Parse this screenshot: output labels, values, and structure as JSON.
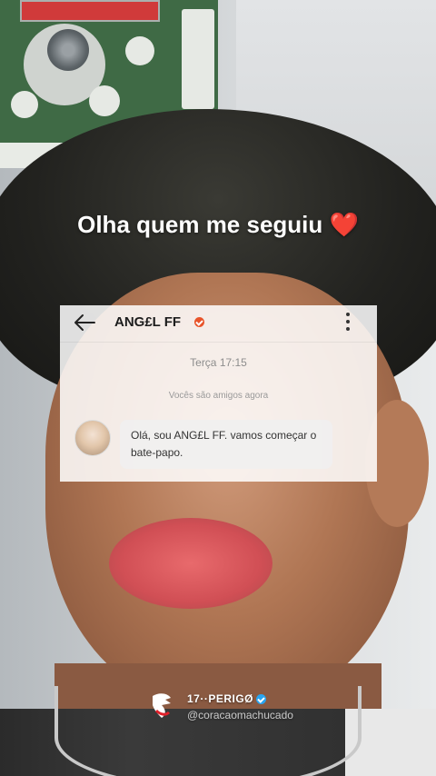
{
  "caption": {
    "text": "Olha quem me seguiu",
    "emoji": "❤️"
  },
  "chat": {
    "contact_name": "ANG£L FF",
    "timestamp": "Terça 17:15",
    "system_message": "Vocês são amigos agora",
    "message": "Olá, sou ANG£L FF. vamos começar o bate-papo.",
    "icons": {
      "back": "back-arrow-icon",
      "verified": "verified-badge-icon",
      "menu": "more-vertical-icon"
    },
    "colors": {
      "verified_badge": "#e8542a"
    }
  },
  "footer": {
    "username": "17··PERIGØ",
    "handle": "@coracaomachucado",
    "verified_color": "#28a4f0"
  }
}
